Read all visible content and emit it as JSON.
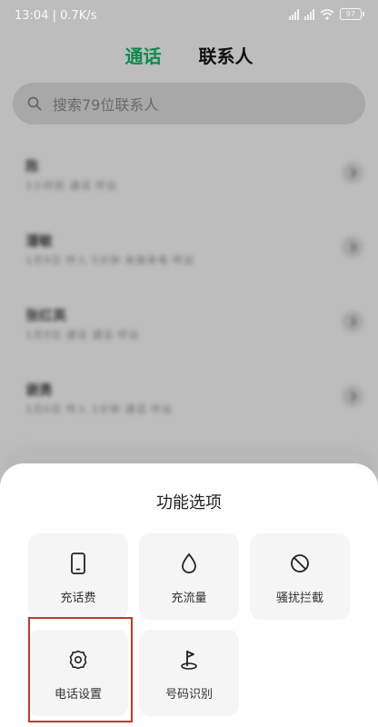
{
  "status_bar": {
    "time_speed": "13:04 | 0.7K/s",
    "battery": "97"
  },
  "tabs": {
    "calls": "通话",
    "contacts": "联系人"
  },
  "search": {
    "placeholder": "搜索79位联系人",
    "icon": "search-icon"
  },
  "contacts": [
    {
      "name": "陈",
      "detail": "1小时前 通话 呼出"
    },
    {
      "name": "潘敏",
      "detail": "1月9日 呼入 5分钟 未接来电 呼出"
    },
    {
      "name": "张红英",
      "detail": "1月8日 通话 通话 呼出"
    },
    {
      "name": "谢勇",
      "detail": "1月6日 呼入 1分钟 通话 呼出"
    }
  ],
  "sheet": {
    "title": "功能选项",
    "tiles": [
      {
        "label": "充话费",
        "icon": "phone-device-icon"
      },
      {
        "label": "充流量",
        "icon": "droplet-icon"
      },
      {
        "label": "骚扰拦截",
        "icon": "block-icon"
      },
      {
        "label": "电话设置",
        "icon": "gear-icon"
      },
      {
        "label": "号码识别",
        "icon": "location-flag-icon"
      }
    ]
  },
  "colors": {
    "accent": "#0d8a4d",
    "highlight": "#c0392b"
  }
}
